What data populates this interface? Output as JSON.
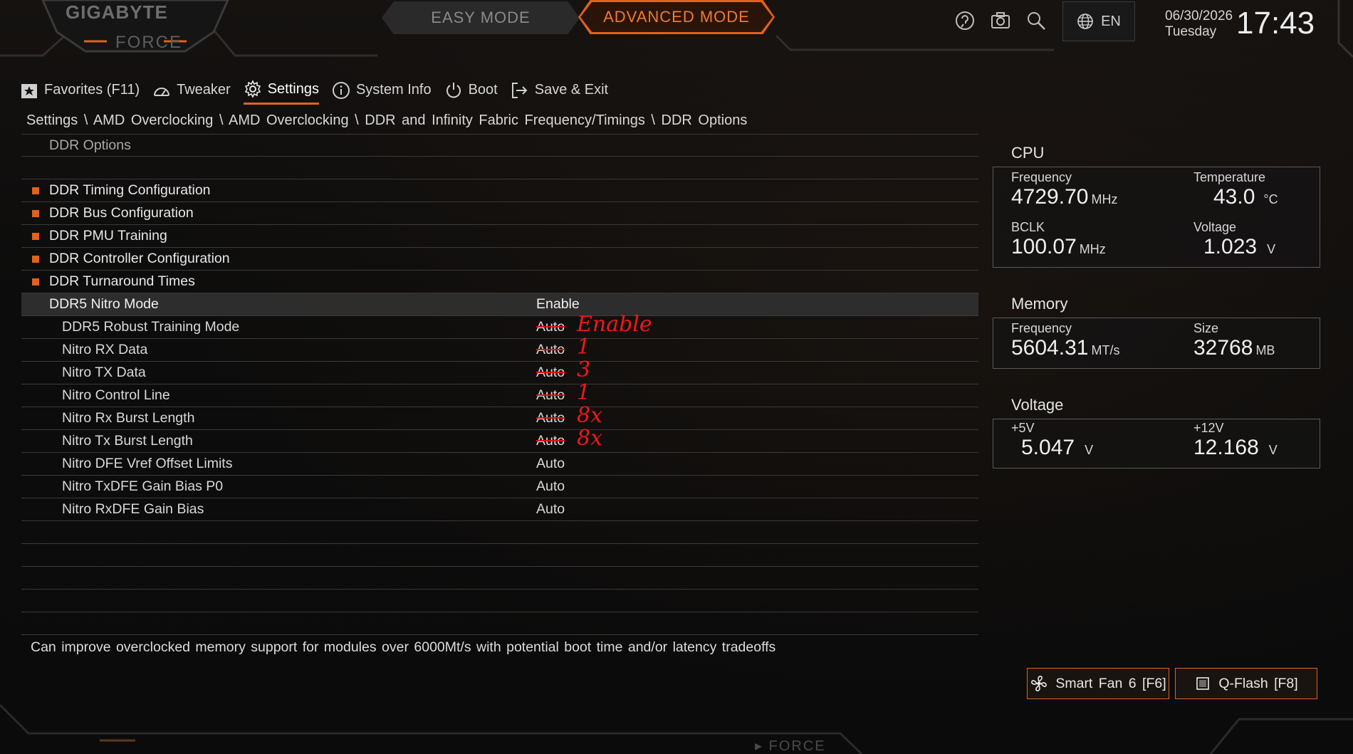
{
  "logo": {
    "brand": "GIGABYTE",
    "sub": "FORCE"
  },
  "modes": {
    "easy": "EASY MODE",
    "advanced": "ADVANCED MODE",
    "active": "advanced"
  },
  "toolbar": {
    "language": "EN",
    "date": "06/30/2026",
    "weekday": "Tuesday",
    "time": "17:43"
  },
  "nav": [
    {
      "label": "Favorites (F11)",
      "icon": "star-icon"
    },
    {
      "label": "Tweaker",
      "icon": "gauge-icon"
    },
    {
      "label": "Settings",
      "icon": "gear-icon",
      "active": true
    },
    {
      "label": "System Info",
      "icon": "info-icon"
    },
    {
      "label": "Boot",
      "icon": "power-icon"
    },
    {
      "label": "Save & Exit",
      "icon": "exit-icon"
    }
  ],
  "breadcrumb": "Settings \\ AMD Overclocking \\ AMD Overclocking \\ DDR and Infinity Fabric Frequency/Timings \\ DDR Options",
  "list": {
    "header": "DDR Options",
    "groups": [
      "DDR Timing Configuration",
      "DDR Bus Configuration",
      "DDR PMU Training",
      "DDR Controller Configuration",
      "DDR Turnaround Times"
    ],
    "selected": {
      "label": "DDR5 Nitro Mode",
      "value": "Enable"
    },
    "items": [
      {
        "label": "DDR5 Robust Training Mode",
        "value": "Auto",
        "struck": true,
        "note": "Enable"
      },
      {
        "label": "Nitro RX Data",
        "value": "Auto",
        "struck": true,
        "note": "1"
      },
      {
        "label": "Nitro TX Data",
        "value": "Auto",
        "struck": true,
        "note": "3"
      },
      {
        "label": "Nitro Control Line",
        "value": "Auto",
        "struck": true,
        "note": "1"
      },
      {
        "label": "Nitro Rx Burst Length",
        "value": "Auto",
        "struck": true,
        "note": "8x"
      },
      {
        "label": "Nitro Tx Burst Length",
        "value": "Auto",
        "struck": true,
        "note": "8x"
      },
      {
        "label": "Nitro DFE Vref Offset Limits",
        "value": "Auto"
      },
      {
        "label": "Nitro TxDFE Gain Bias P0",
        "value": "Auto"
      },
      {
        "label": "Nitro RxDFE Gain Bias",
        "value": "Auto"
      }
    ]
  },
  "help_text": "Can improve overclocked memory support for modules over 6000Mt/s with potential boot time and/or latency tradeoffs",
  "cpu": {
    "title": "CPU",
    "frequency": {
      "label": "Frequency",
      "value": "4729.70",
      "unit": "MHz"
    },
    "temperature": {
      "label": "Temperature",
      "value": "43.0",
      "unit": "°C"
    },
    "bclk": {
      "label": "BCLK",
      "value": "100.07",
      "unit": "MHz"
    },
    "voltage": {
      "label": "Voltage",
      "value": "1.023",
      "unit": "V"
    }
  },
  "memory": {
    "title": "Memory",
    "frequency": {
      "label": "Frequency",
      "value": "5604.31",
      "unit": "MT/s"
    },
    "size": {
      "label": "Size",
      "value": "32768",
      "unit": "MB"
    }
  },
  "voltage": {
    "title": "Voltage",
    "v5": {
      "label": "+5V",
      "value": "5.047",
      "unit": "V"
    },
    "v12": {
      "label": "+12V",
      "value": "12.168",
      "unit": "V"
    }
  },
  "buttons": {
    "smart_fan": "Smart Fan 6 [F6]",
    "qflash": "Q-Flash [F8]"
  },
  "colors": {
    "accent": "#e0621c",
    "annotation": "#f01818"
  }
}
